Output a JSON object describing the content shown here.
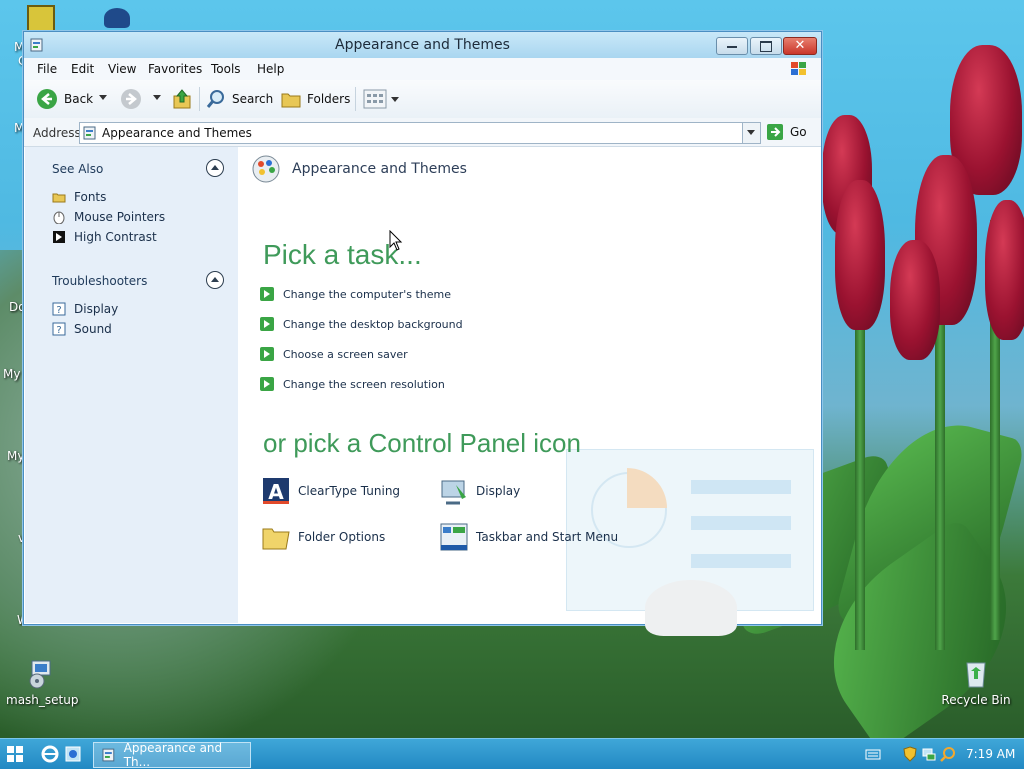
{
  "desktop": {
    "icons": [
      {
        "label": "mash_setup",
        "name": "mash-setup"
      },
      {
        "label": "Recycle Bin",
        "name": "recycle-bin"
      }
    ],
    "edge_labels": [
      "M",
      "C",
      "M",
      "Do",
      "My",
      "My",
      "v",
      "W"
    ]
  },
  "window": {
    "title": "Appearance and Themes",
    "menu": [
      "File",
      "Edit",
      "View",
      "Favorites",
      "Tools",
      "Help"
    ],
    "toolbar": {
      "back": "Back",
      "search": "Search",
      "folders": "Folders"
    },
    "address": {
      "label": "Address",
      "value": "Appearance and Themes",
      "go": "Go"
    },
    "sidebar": {
      "see_also": {
        "title": "See Also",
        "items": [
          "Fonts",
          "Mouse Pointers",
          "High Contrast"
        ]
      },
      "troubleshooters": {
        "title": "Troubleshooters",
        "items": [
          "Display",
          "Sound"
        ]
      }
    },
    "content": {
      "header": "Appearance and Themes",
      "pick_task": "Pick a task...",
      "tasks": [
        "Change the computer's theme",
        "Change the desktop background",
        "Choose a screen saver",
        "Change the screen resolution"
      ],
      "pick_icon": "or pick a Control Panel icon",
      "icons": [
        "ClearType Tuning",
        "Display",
        "Folder Options",
        "Taskbar and Start Menu"
      ]
    }
  },
  "taskbar": {
    "app_label": "Appearance and Th...",
    "clock": "7:19 AM"
  },
  "colors": {
    "accent_green": "#3f9a5a",
    "taskbar_blue": "#2289c3"
  }
}
